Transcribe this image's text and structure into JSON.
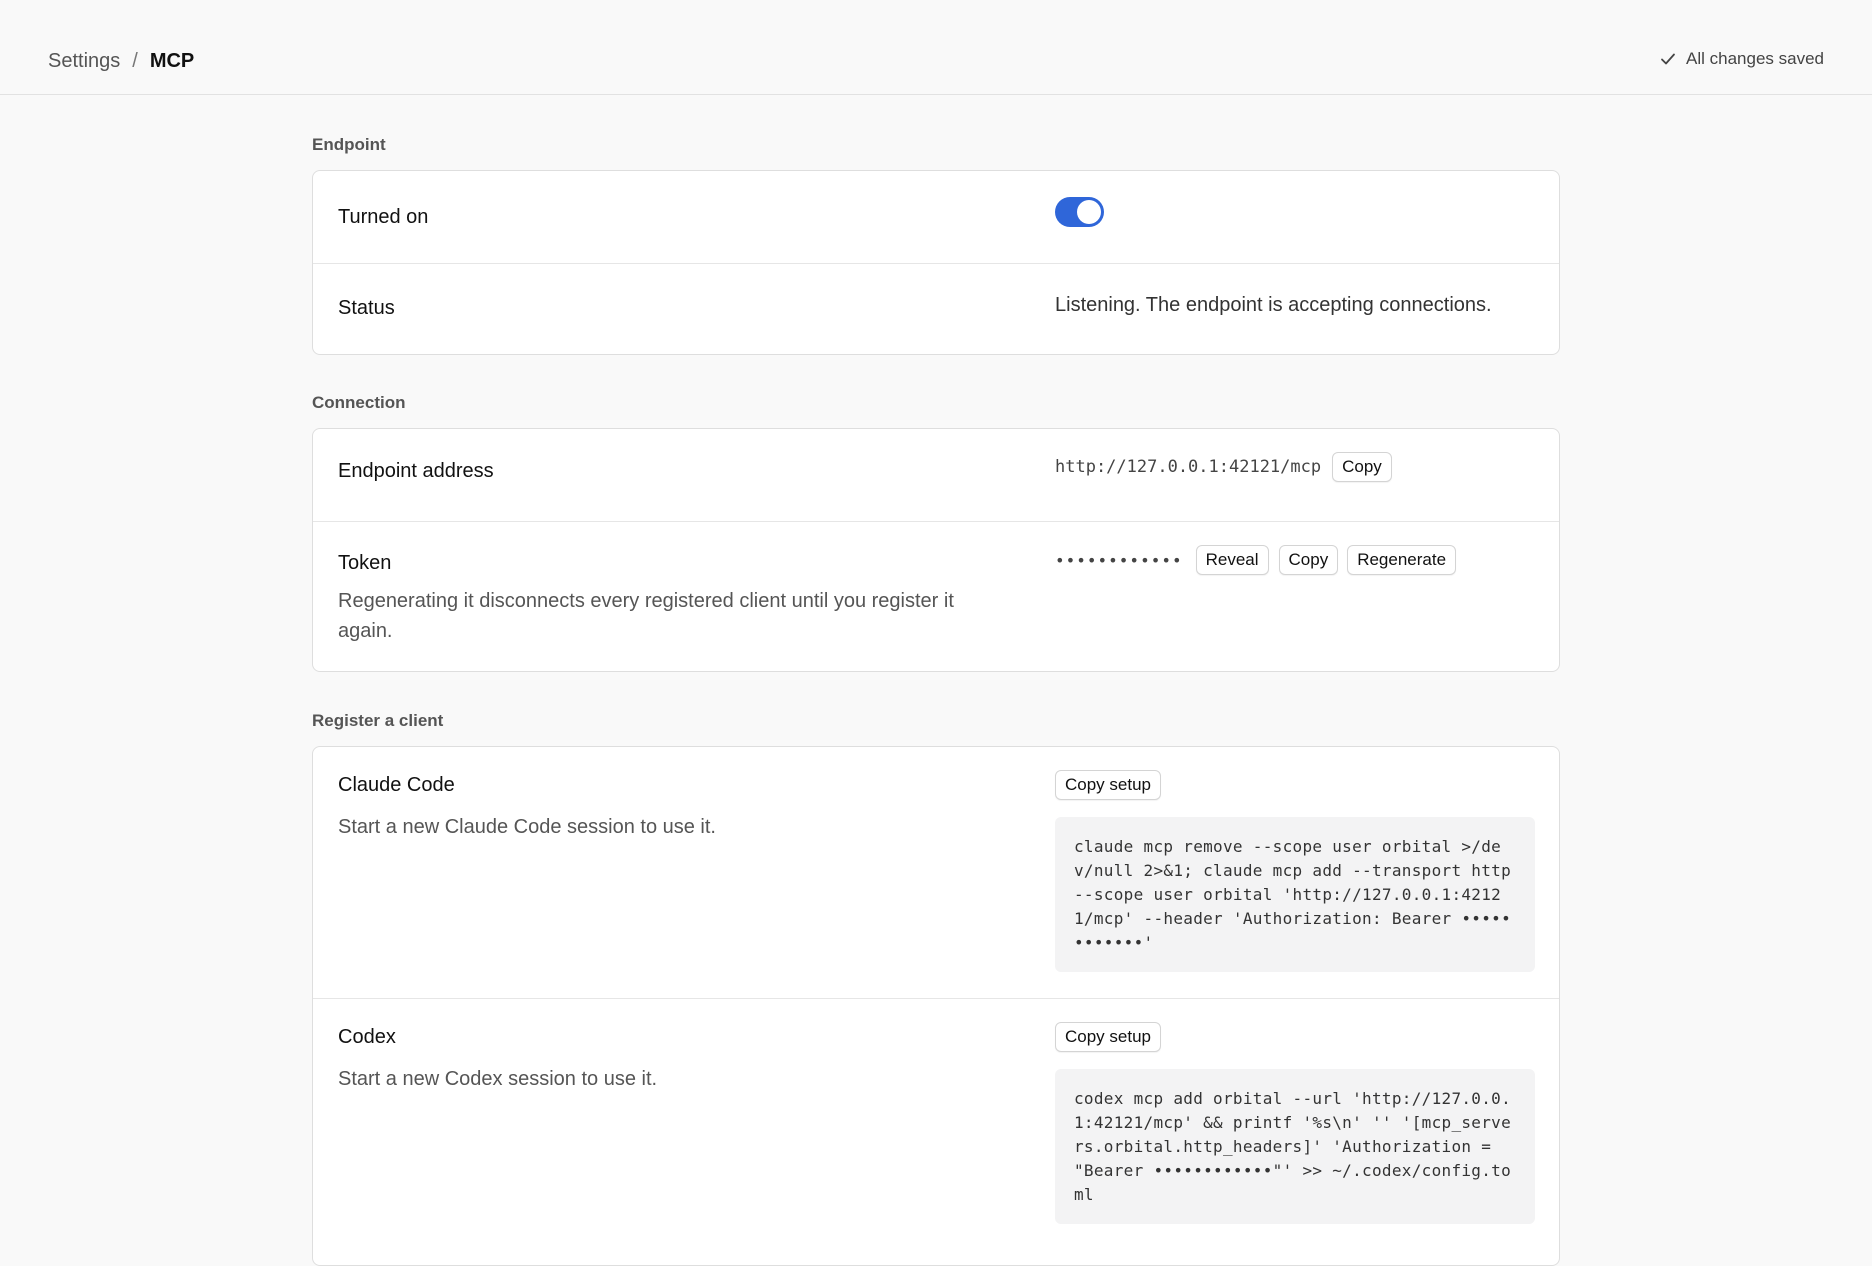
{
  "header": {
    "breadcrumb_root": "Settings",
    "breadcrumb_sep": "/",
    "breadcrumb_current": "MCP",
    "save_status": "All changes saved"
  },
  "sections": {
    "endpoint": {
      "title": "Endpoint",
      "turned_on_label": "Turned on",
      "turned_on_state": true,
      "status_label": "Status",
      "status_value": "Listening. The endpoint is accepting connections."
    },
    "connection": {
      "title": "Connection",
      "address_label": "Endpoint address",
      "address_value": "http://127.0.0.1:42121/mcp",
      "copy_label": "Copy",
      "token_label": "Token",
      "token_desc": "Regenerating it disconnects every registered client until you register it again.",
      "token_masked": "••••••••••••",
      "reveal_label": "Reveal",
      "token_copy_label": "Copy",
      "regenerate_label": "Regenerate"
    },
    "register": {
      "title": "Register a client",
      "clients": [
        {
          "name": "Claude Code",
          "desc": "Start a new Claude Code session to use it.",
          "button": "Copy setup",
          "command": "claude mcp remove --scope user orbital >/dev/null 2>&1; claude mcp add --transport http --scope user orbital 'http://127.0.0.1:42121/mcp' --header 'Authorization: Bearer ••••••••••••'"
        },
        {
          "name": "Codex",
          "desc": "Start a new Codex session to use it.",
          "button": "Copy setup",
          "command": "codex mcp add orbital --url 'http://127.0.0.1:42121/mcp' && printf '%s\\n' '' '[mcp_servers.orbital.http_headers]' 'Authorization = \"Bearer ••••••••••••\"' >> ~/.codex/config.toml"
        }
      ]
    }
  },
  "colors": {
    "accent": "#2f66d9",
    "background": "#f9f9f9",
    "card": "#ffffff",
    "code_bg": "#f3f3f4"
  }
}
